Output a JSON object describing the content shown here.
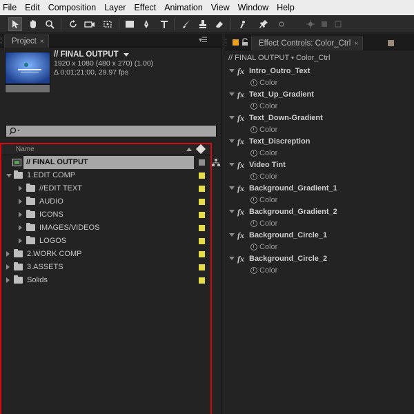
{
  "menu": [
    "File",
    "Edit",
    "Composition",
    "Layer",
    "Effect",
    "Animation",
    "View",
    "Window",
    "Help"
  ],
  "toolbar": {
    "tools": [
      "selection-tool-icon",
      "hand-tool-icon",
      "zoom-tool-icon",
      "rotation-tool-icon",
      "camera-tool-icon",
      "pan-behind-tool-icon",
      "rectangle-tool-icon",
      "pen-tool-icon",
      "type-tool-icon",
      "brush-tool-icon",
      "clone-stamp-tool-icon",
      "eraser-tool-icon",
      "roto-brush-tool-icon",
      "puppet-pin-tool-icon"
    ]
  },
  "project_panel": {
    "tab_label": "Project",
    "selected_item": {
      "title": "// FINAL OUTPUT",
      "resolution": "1920 x 1080  (480 x 270) (1.00)",
      "duration": "Δ 0;01;21;00, 29.97 fps"
    },
    "list_header": {
      "name": "Name"
    },
    "rows": [
      {
        "label": "// FINAL OUTPUT",
        "type": "comp",
        "level": 0,
        "expanded": null,
        "selected": true
      },
      {
        "label": "1.EDIT COMP",
        "type": "folder",
        "level": 0,
        "expanded": true,
        "selected": false
      },
      {
        "label": "//EDIT TEXT",
        "type": "folder",
        "level": 1,
        "expanded": false,
        "selected": false
      },
      {
        "label": "AUDIO",
        "type": "folder",
        "level": 1,
        "expanded": false,
        "selected": false
      },
      {
        "label": "ICONS",
        "type": "folder",
        "level": 1,
        "expanded": false,
        "selected": false
      },
      {
        "label": "IMAGES/VIDEOS",
        "type": "folder",
        "level": 1,
        "expanded": false,
        "selected": false
      },
      {
        "label": "LOGOS",
        "type": "folder",
        "level": 1,
        "expanded": false,
        "selected": false
      },
      {
        "label": "2.WORK COMP",
        "type": "folder",
        "level": 0,
        "expanded": false,
        "selected": false
      },
      {
        "label": "3.ASSETS",
        "type": "folder",
        "level": 0,
        "expanded": false,
        "selected": false
      },
      {
        "label": "Solids",
        "type": "folder",
        "level": 0,
        "expanded": false,
        "selected": false
      }
    ],
    "label_color": "#e6dc49",
    "highlight_color": "#d40b12"
  },
  "effect_panel": {
    "tab_label": "Effect Controls: Color_Ctrl",
    "comp_path": "// FINAL OUTPUT • Color_Ctrl",
    "fx_symbol": "fx",
    "effects": [
      {
        "name": "Intro_Outro_Text",
        "property": "Color"
      },
      {
        "name": "Text_Up_Gradient",
        "property": "Color"
      },
      {
        "name": "Text_Down-Gradient",
        "property": "Color"
      },
      {
        "name": "Text_Discreption",
        "property": "Color"
      },
      {
        "name": "Video Tint",
        "property": "Color"
      },
      {
        "name": "Background_Gradient_1",
        "property": "Color"
      },
      {
        "name": "Background_Gradient_2",
        "property": "Color"
      },
      {
        "name": "Background_Circle_1",
        "property": "Color"
      },
      {
        "name": "Background_Circle_2",
        "property": "Color"
      }
    ]
  }
}
